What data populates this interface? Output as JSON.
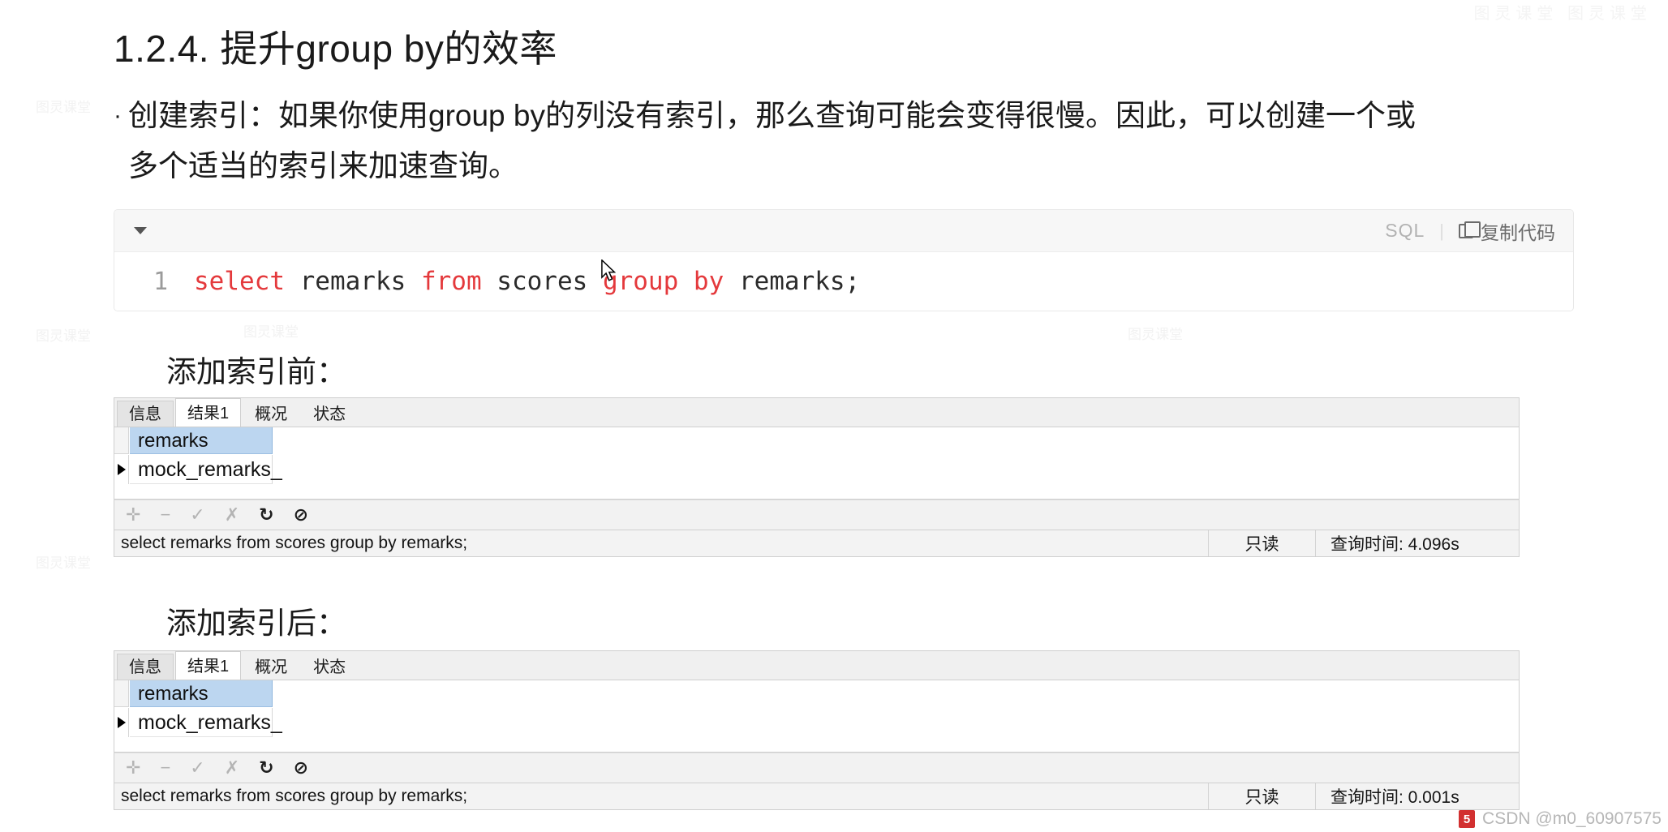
{
  "page": {
    "top_watermark": "图灵课堂 图灵课堂",
    "heading": "1.2.4. 提升group by的效率",
    "bullet": {
      "marker": "·",
      "line1": "创建索引：如果你使用group by的列没有索引，那么查询可能会变得很慢。因此，可以创建一个或",
      "line2": "多个适当的索引来加速查询。"
    }
  },
  "code_block": {
    "caret_icon": "chevron-down-icon",
    "language": "SQL",
    "separator": "|",
    "copy_icon": "copy-icon",
    "copy_label": "复制代码",
    "line_number": "1",
    "tokens": [
      {
        "text": "select",
        "type": "keyword"
      },
      {
        "text": " remarks ",
        "type": "plain"
      },
      {
        "text": "from",
        "type": "keyword"
      },
      {
        "text": " scores ",
        "type": "plain"
      },
      {
        "text": "group by",
        "type": "keyword"
      },
      {
        "text": " remarks;",
        "type": "plain"
      }
    ],
    "full_text": "select remarks from scores group by remarks;",
    "keyword_color": "#e4393c",
    "text_color": "#2b2b2b"
  },
  "sections": [
    {
      "label": "添加索引前：",
      "tabs": [
        {
          "label": "信息",
          "active": false
        },
        {
          "label": "结果1",
          "active": true
        },
        {
          "label": "概况",
          "active": false
        },
        {
          "label": "状态",
          "active": false
        }
      ],
      "grid": {
        "column_header": "remarks",
        "header_bg": "#bcd6f0",
        "row_marker_icon": "row-pointer-icon",
        "cell_value": "mock_remarks_"
      },
      "toolbar": [
        {
          "icon": "plus-icon",
          "glyph": "✛",
          "dark": false
        },
        {
          "icon": "minus-icon",
          "glyph": "−",
          "dark": false
        },
        {
          "icon": "check-icon",
          "glyph": "✓",
          "dark": false
        },
        {
          "icon": "cross-icon",
          "glyph": "✗",
          "dark": false
        },
        {
          "icon": "refresh-icon",
          "glyph": "↻",
          "dark": true
        },
        {
          "icon": "stop-icon",
          "glyph": "⊘",
          "dark": true
        }
      ],
      "status": {
        "sql": "select remarks from scores group by remarks;",
        "readonly": "只读",
        "query_time": "查询时间: 4.096s"
      }
    },
    {
      "label": "添加索引后：",
      "tabs": [
        {
          "label": "信息",
          "active": false
        },
        {
          "label": "结果1",
          "active": true
        },
        {
          "label": "概况",
          "active": false
        },
        {
          "label": "状态",
          "active": false
        }
      ],
      "grid": {
        "column_header": "remarks",
        "header_bg": "#bcd6f0",
        "row_marker_icon": "row-pointer-icon",
        "cell_value": "mock_remarks_"
      },
      "toolbar": [
        {
          "icon": "plus-icon",
          "glyph": "✛",
          "dark": false
        },
        {
          "icon": "minus-icon",
          "glyph": "−",
          "dark": false
        },
        {
          "icon": "check-icon",
          "glyph": "✓",
          "dark": false
        },
        {
          "icon": "cross-icon",
          "glyph": "✗",
          "dark": false
        },
        {
          "icon": "refresh-icon",
          "glyph": "↻",
          "dark": true
        },
        {
          "icon": "stop-icon",
          "glyph": "⊘",
          "dark": true
        }
      ],
      "status": {
        "sql": "select remarks from scores group by remarks;",
        "readonly": "只读",
        "query_time": "查询时间: 0.001s"
      }
    }
  ],
  "watermarks": {
    "body": "图灵课堂",
    "csdn_logo": "5",
    "csdn_text": "CSDN @m0_60907575"
  }
}
